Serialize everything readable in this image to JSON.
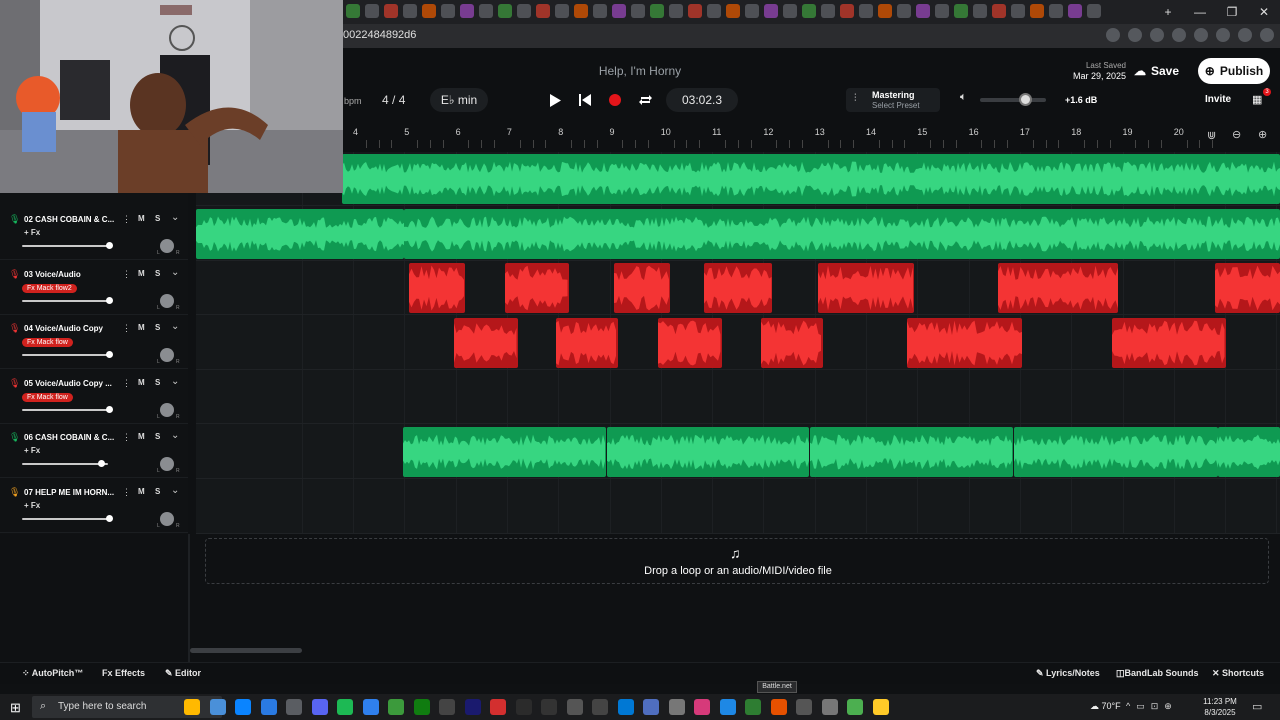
{
  "browser": {
    "url": "0022484892d6"
  },
  "project": {
    "title": "Help, I'm Horny",
    "last_saved_label": "Last Saved",
    "last_saved_date": "Mar 29, 2025",
    "save_label": "Save",
    "publish_label": "Publish",
    "invite_label": "Invite",
    "notifications_badge": "3"
  },
  "transport": {
    "bpm_label": "bpm",
    "time_signature_num": "4",
    "time_signature_sep": "/",
    "time_signature_den": "4",
    "key_label": "E♭ min",
    "time_display": "03:02.3",
    "mastering_title": "Mastering",
    "mastering_preset": "Select Preset",
    "master_gain": "+1.6 dB",
    "master_volume_fraction": 0.7
  },
  "ruler": {
    "bars": [
      "4",
      "5",
      "6",
      "7",
      "8",
      "9",
      "10",
      "11",
      "12",
      "13",
      "14",
      "15",
      "16",
      "17",
      "18",
      "19",
      "20"
    ]
  },
  "tracks": [
    {
      "name": "02  CASH COBAIN & C...",
      "fx": "+ Fx",
      "fx_tag": "",
      "volume_fraction": 1.0,
      "color": "#16b85e"
    },
    {
      "name": "03  Voice/Audio",
      "fx": "",
      "fx_tag": "Fx Mack flow2",
      "volume_fraction": 1.0,
      "color": "#e33"
    },
    {
      "name": "04  Voice/Audio Copy",
      "fx": "",
      "fx_tag": "Fx Mack flow",
      "volume_fraction": 1.0,
      "color": "#e33"
    },
    {
      "name": "05  Voice/Audio Copy ...",
      "fx": "",
      "fx_tag": "Fx Mack flow",
      "volume_fraction": 1.0,
      "color": "#e33"
    },
    {
      "name": "06  CASH COBAIN & C...",
      "fx": "+ Fx",
      "fx_tag": "",
      "volume_fraction": 0.9,
      "color": "#16b85e"
    },
    {
      "name": "07  HELP ME IM HORN...",
      "fx": "+ Fx",
      "fx_tag": "",
      "volume_fraction": 1.0,
      "color": "#f0a020"
    }
  ],
  "track_controls": {
    "mute": "M",
    "solo": "S",
    "menu": "⋮",
    "chevron": "⌄",
    "pan_l": "L",
    "pan_r": "R"
  },
  "dropzone": {
    "text": "Drop a loop or an audio/MIDI/video file"
  },
  "bottom_toolbar": {
    "autopitch": "AutoPitch™",
    "effects": "Effects",
    "editor": "Editor",
    "lyrics": "Lyrics/Notes",
    "sounds": "BandLab Sounds",
    "shortcuts": "Shortcuts"
  },
  "taskbar": {
    "search_placeholder": "Type here to search",
    "tooltip": "Battle.net",
    "weather": "70°F",
    "time": "11:23 PM",
    "date": "8/3/2025"
  },
  "colors": {
    "green_clip": "#0f9a52",
    "red_clip": "#b5171a",
    "background": "#15181a"
  }
}
